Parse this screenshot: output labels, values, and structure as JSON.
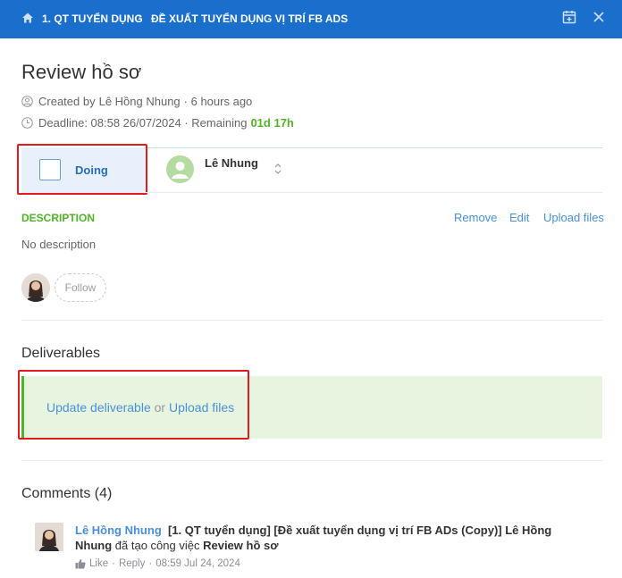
{
  "breadcrumb": {
    "items": [
      "1. QT TUYỂN DỤNG",
      "ĐỀ XUẤT TUYỂN DỤNG VỊ TRÍ FB ADS"
    ],
    "separator": "›"
  },
  "task": {
    "title": "Review hồ sơ",
    "created_prefix": "Created by",
    "created_by": "Lê Hồng Nhung",
    "created_ago": "· 6 hours ago",
    "deadline_text": "Deadline: 08:58 26/07/2024 · Remaining",
    "remaining": "01d 17h",
    "status": "Doing",
    "assignee": "Lê Nhung"
  },
  "description": {
    "label": "DESCRIPTION",
    "actions": [
      "Remove",
      "Edit",
      "Upload files"
    ],
    "text": "No description"
  },
  "followers": {
    "follow_label": "Follow"
  },
  "deliverables": {
    "title": "Deliverables",
    "update_label": "Update deliverable",
    "or_label": "or",
    "upload_label": "Upload files"
  },
  "comments": {
    "title": "Comments (4)",
    "items": [
      {
        "author": "Lê Hồng Nhung",
        "text_1": "[1. QT tuyển dụng] [Đề xuất tuyển dụng vị trí FB ADs (Copy)] Lê Hồng Nhung",
        "text_2": "đã tạo công việc",
        "text_3": "Review hồ sơ",
        "like": "Like",
        "reply": "Reply",
        "time": "08:59 Jul 24, 2024"
      }
    ]
  },
  "colors": {
    "topbar": "#1a6fcc",
    "accent_green": "#52b228",
    "link_blue": "#4a90d9",
    "highlight_red": "#e11b1b"
  }
}
